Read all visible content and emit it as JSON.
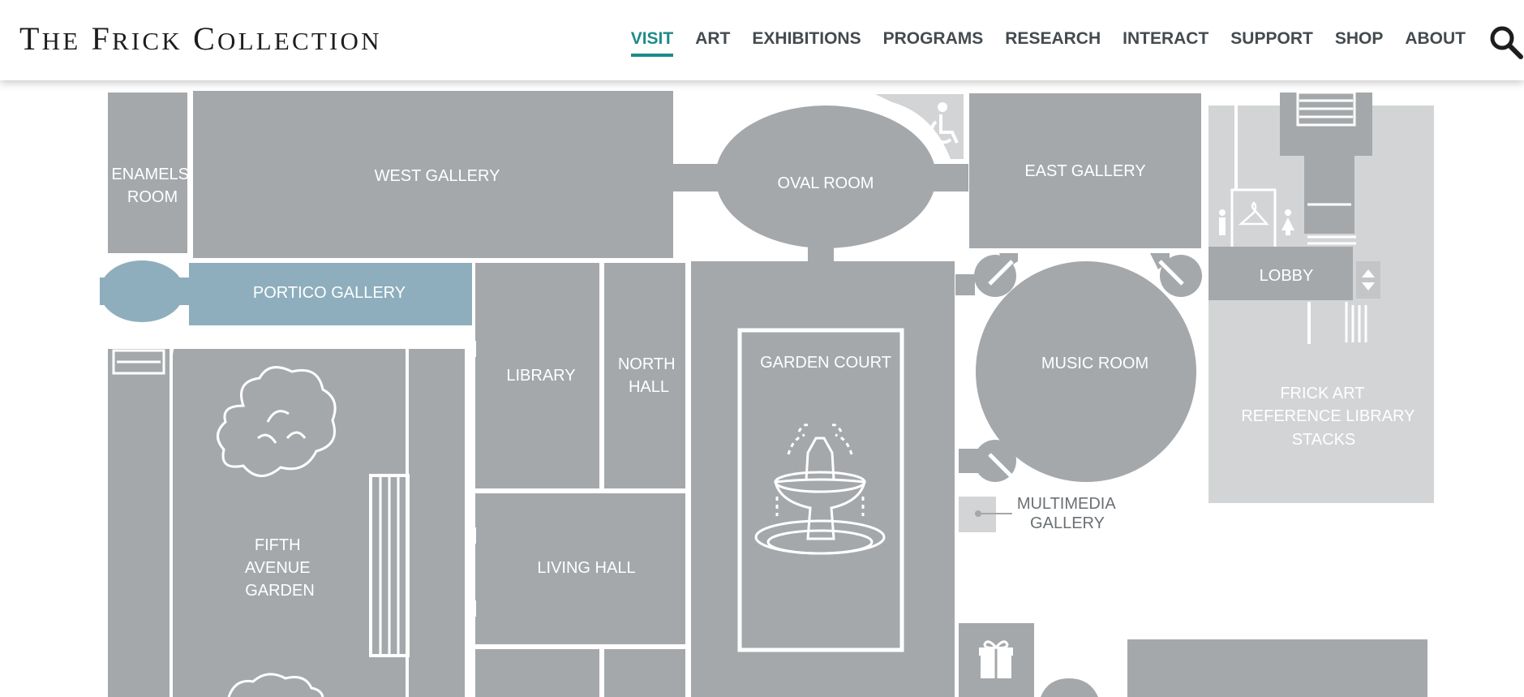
{
  "header": {
    "logo": {
      "first": "T",
      "w1": "HE",
      "second": "F",
      "w2": "RICK",
      "third": "C",
      "w3": "OLLECTION"
    },
    "nav": [
      {
        "label": "VISIT",
        "active": true
      },
      {
        "label": "ART",
        "active": false
      },
      {
        "label": "EXHIBITIONS",
        "active": false
      },
      {
        "label": "PROGRAMS",
        "active": false
      },
      {
        "label": "RESEARCH",
        "active": false
      },
      {
        "label": "INTERACT",
        "active": false
      },
      {
        "label": "SUPPORT",
        "active": false
      },
      {
        "label": "SHOP",
        "active": false
      },
      {
        "label": "ABOUT",
        "active": false
      }
    ],
    "search_icon": "search-icon"
  },
  "map": {
    "colors": {
      "room": "#a5a8ab",
      "highlight": "#8eaebd",
      "library_area": "#d3d4d5",
      "header_accent": "#1f8a8a"
    },
    "rooms": {
      "enamels_room": [
        "ENAMELS",
        "ROOM"
      ],
      "west_gallery": "WEST GALLERY",
      "oval_room": "OVAL ROOM",
      "east_gallery": "EAST GALLERY",
      "portico_gallery": "PORTICO GALLERY",
      "library": "LIBRARY",
      "north_hall": [
        "NORTH",
        "HALL"
      ],
      "garden_court": "GARDEN COURT",
      "music_room": "MUSIC ROOM",
      "lobby": "LOBBY",
      "frick_art_reference_library_stacks": [
        "FRICK ART",
        "REFERENCE LIBRARY",
        "STACKS"
      ],
      "multimedia_gallery": [
        "MULTIMEDIA",
        "GALLERY"
      ],
      "living_hall": "LIVING HALL",
      "fifth_avenue_garden": [
        "FIFTH",
        "AVENUE",
        "GARDEN"
      ]
    },
    "icons": [
      "wheelchair-accessible-icon",
      "coat-check-icon",
      "restroom-men-icon",
      "restroom-women-icon",
      "elevator-icon",
      "stairs-icon",
      "gift-shop-icon",
      "fountain-icon",
      "tree-icon"
    ]
  }
}
